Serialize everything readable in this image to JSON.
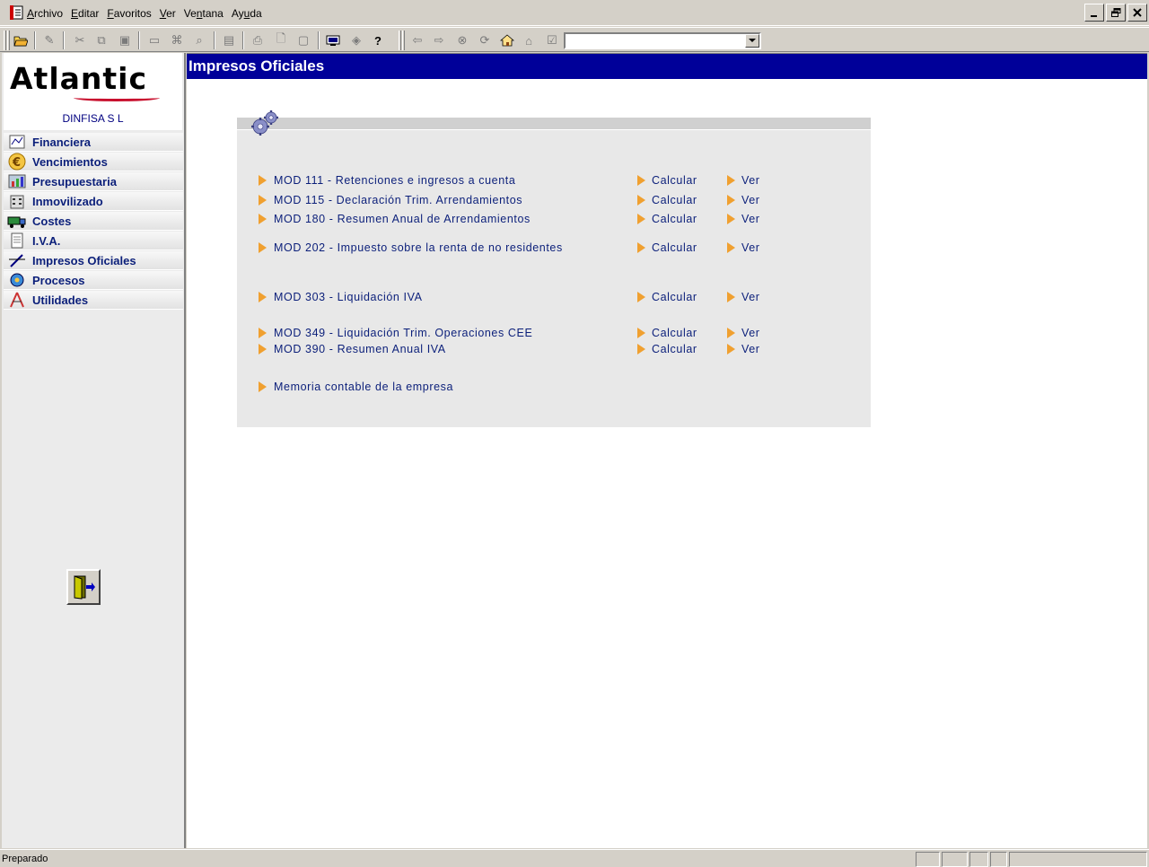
{
  "menubar": {
    "items": [
      {
        "pre": "",
        "u": "A",
        "post": "rchivo"
      },
      {
        "pre": "",
        "u": "E",
        "post": "ditar"
      },
      {
        "pre": "",
        "u": "F",
        "post": "avoritos"
      },
      {
        "pre": "",
        "u": "V",
        "post": "er"
      },
      {
        "pre": "Ve",
        "u": "n",
        "post": "tana"
      },
      {
        "pre": "Ay",
        "u": "u",
        "post": "da"
      }
    ]
  },
  "toolbar": {
    "icons": [
      "open-icon",
      "edit-icon",
      "cut-icon",
      "copy-icon",
      "paste-icon",
      "window-icon",
      "find-icon",
      "search-icon",
      "scanner-icon",
      "print-icon",
      "print-preview-icon",
      "save-icon",
      "monitor-icon",
      "tag-icon",
      "help-icon",
      "back-icon",
      "forward-icon",
      "stop-icon",
      "refresh-icon",
      "home-icon",
      "favorites-icon",
      "history-icon"
    ],
    "address_value": ""
  },
  "sidebar": {
    "logo_text": "Atlantic",
    "logo_subtext": "Dinfisa",
    "company": "DINFISA  S L",
    "items": [
      {
        "label": "Financiera",
        "icon": "ledger-icon"
      },
      {
        "label": "Vencimientos",
        "icon": "euro-icon"
      },
      {
        "label": "Presupuestaria",
        "icon": "chart-icon"
      },
      {
        "label": "Inmovilizado",
        "icon": "building-icon"
      },
      {
        "label": "Costes",
        "icon": "truck-icon"
      },
      {
        "label": "I.V.A.",
        "icon": "document-icon"
      },
      {
        "label": "Impresos Oficiales",
        "icon": "pen-icon"
      },
      {
        "label": "Procesos",
        "icon": "gear-icon"
      },
      {
        "label": "Utilidades",
        "icon": "compass-icon"
      }
    ]
  },
  "main": {
    "title": "Impresos Oficiales",
    "calc_label": "Calcular",
    "ver_label": "Ver",
    "forms": [
      {
        "label": "MOD 111 - Retenciones e ingresos a cuenta"
      },
      {
        "label": "MOD 115 - Declaración Trim. Arrendamientos"
      },
      {
        "label": "MOD 180 - Resumen Anual de Arrendamientos"
      },
      {
        "label": "MOD 202 - Impuesto sobre la renta de no residentes"
      },
      {
        "label": "MOD 303 - Liquidación IVA"
      },
      {
        "label": "MOD 349 - Liquidación Trim. Operaciones CEE"
      },
      {
        "label": "MOD 390 - Resumen Anual IVA"
      }
    ],
    "memoria": "Memoria contable de la empresa"
  },
  "statusbar": {
    "text": "Preparado"
  },
  "colors": {
    "title_bg": "#000099",
    "link": "#0b1f7a",
    "arrow": "#f0a030"
  }
}
